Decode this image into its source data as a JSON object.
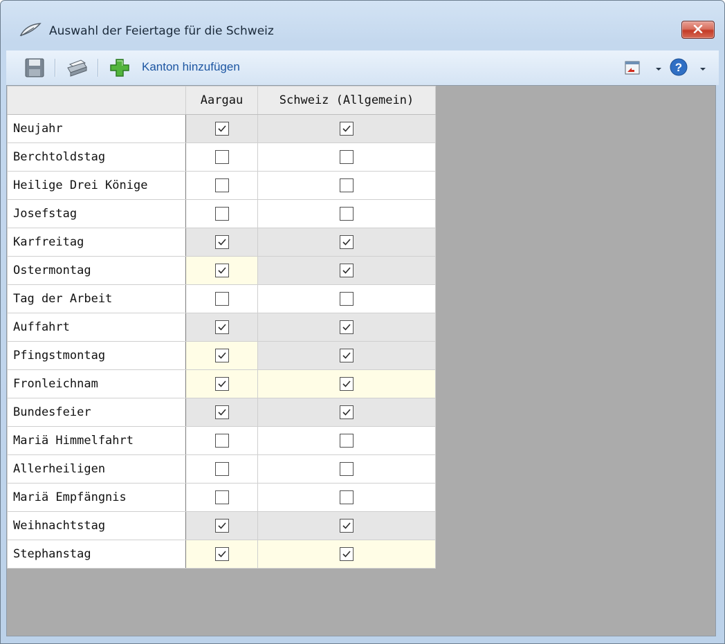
{
  "window": {
    "title": "Auswahl der Feiertage für die Schweiz"
  },
  "toolbar": {
    "add_canton_label": "Kanton hinzufügen"
  },
  "table": {
    "columns": [
      "Aargau",
      "Schweiz (Allgemein)"
    ],
    "rows": [
      {
        "name": "Neujahr",
        "cells": [
          {
            "checked": true,
            "highlight": "none"
          },
          {
            "checked": true,
            "highlight": "none"
          }
        ]
      },
      {
        "name": "Berchtoldstag",
        "cells": [
          {
            "checked": false,
            "highlight": "none"
          },
          {
            "checked": false,
            "highlight": "none"
          }
        ]
      },
      {
        "name": "Heilige Drei Könige",
        "cells": [
          {
            "checked": false,
            "highlight": "none"
          },
          {
            "checked": false,
            "highlight": "none"
          }
        ]
      },
      {
        "name": "Josefstag",
        "cells": [
          {
            "checked": false,
            "highlight": "none"
          },
          {
            "checked": false,
            "highlight": "none"
          }
        ]
      },
      {
        "name": "Karfreitag",
        "cells": [
          {
            "checked": true,
            "highlight": "none"
          },
          {
            "checked": true,
            "highlight": "none"
          }
        ]
      },
      {
        "name": "Ostermontag",
        "cells": [
          {
            "checked": true,
            "highlight": "yellow"
          },
          {
            "checked": true,
            "highlight": "none"
          }
        ]
      },
      {
        "name": "Tag der Arbeit",
        "cells": [
          {
            "checked": false,
            "highlight": "none"
          },
          {
            "checked": false,
            "highlight": "none"
          }
        ]
      },
      {
        "name": "Auffahrt",
        "cells": [
          {
            "checked": true,
            "highlight": "none"
          },
          {
            "checked": true,
            "highlight": "none"
          }
        ]
      },
      {
        "name": "Pfingstmontag",
        "cells": [
          {
            "checked": true,
            "highlight": "yellow"
          },
          {
            "checked": true,
            "highlight": "none"
          }
        ]
      },
      {
        "name": "Fronleichnam",
        "cells": [
          {
            "checked": true,
            "highlight": "yellow"
          },
          {
            "checked": true,
            "highlight": "yellow"
          }
        ]
      },
      {
        "name": "Bundesfeier",
        "cells": [
          {
            "checked": true,
            "highlight": "none"
          },
          {
            "checked": true,
            "highlight": "none"
          }
        ]
      },
      {
        "name": "Mariä Himmelfahrt",
        "cells": [
          {
            "checked": false,
            "highlight": "none"
          },
          {
            "checked": false,
            "highlight": "none"
          }
        ]
      },
      {
        "name": "Allerheiligen",
        "cells": [
          {
            "checked": false,
            "highlight": "none"
          },
          {
            "checked": false,
            "highlight": "none"
          }
        ]
      },
      {
        "name": "Mariä Empfängnis",
        "cells": [
          {
            "checked": false,
            "highlight": "none"
          },
          {
            "checked": false,
            "highlight": "none"
          }
        ]
      },
      {
        "name": "Weihnachtstag",
        "cells": [
          {
            "checked": true,
            "highlight": "none"
          },
          {
            "checked": true,
            "highlight": "none"
          }
        ]
      },
      {
        "name": "Stephanstag",
        "cells": [
          {
            "checked": true,
            "highlight": "yellow"
          },
          {
            "checked": true,
            "highlight": "yellow"
          }
        ]
      }
    ]
  },
  "colors": {
    "accent_text": "#1d56a2",
    "checked_bg": "#e6e6e6",
    "highlight_bg": "#fffde6",
    "empty_area": "#ababab",
    "close_button": "#c33a26"
  },
  "icons": {
    "title": "holiday-feather-icon",
    "save": "floppy-disk-icon",
    "print": "printer-icon",
    "add": "green-plus-icon",
    "export": "export-icon",
    "help": "help-icon"
  }
}
